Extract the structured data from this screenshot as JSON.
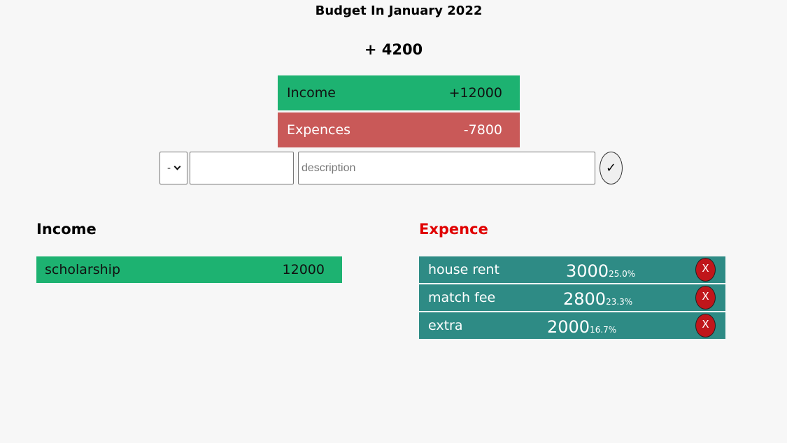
{
  "header": {
    "title": "Budget In January 2022",
    "total": "+ 4200"
  },
  "summary": {
    "income_label": "Income",
    "income_value": "+12000",
    "expense_label": "Expences",
    "expense_value": "-7800"
  },
  "form": {
    "type_value": "-",
    "amount_value": "",
    "description_placeholder": "description",
    "submit_label": "✓"
  },
  "income": {
    "heading": "Income",
    "items": [
      {
        "description": "scholarship",
        "amount": "12000"
      }
    ]
  },
  "expense": {
    "heading": "Expence",
    "items": [
      {
        "description": "house rent",
        "amount": "3000",
        "percent": "25.0%",
        "delete_label": "X"
      },
      {
        "description": "match fee",
        "amount": "2800",
        "percent": "23.3%",
        "delete_label": "X"
      },
      {
        "description": "extra",
        "amount": "2000",
        "percent": "16.7%",
        "delete_label": "X"
      }
    ]
  },
  "colors": {
    "income_green": "#1db271",
    "expense_red": "#c95958",
    "expense_row_teal": "#2e8b85",
    "expense_heading": "#e00000",
    "delete_button": "#c0161b"
  }
}
